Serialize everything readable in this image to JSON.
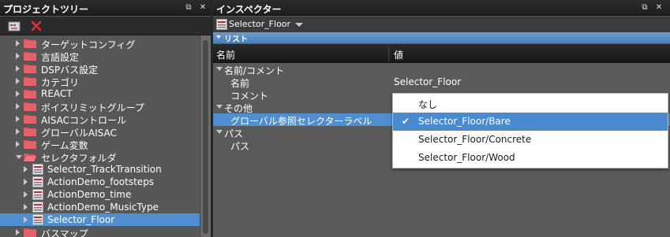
{
  "project_tree": {
    "title": "プロジェクトツリー",
    "items": [
      {
        "label": "ターゲットコンフィグ",
        "kind": "folder",
        "expanded": false,
        "selected": false
      },
      {
        "label": "言語設定",
        "kind": "folder",
        "expanded": false,
        "selected": false
      },
      {
        "label": "DSPバス設定",
        "kind": "folder",
        "expanded": false,
        "selected": false
      },
      {
        "label": "カテゴリ",
        "kind": "folder",
        "expanded": false,
        "selected": false
      },
      {
        "label": "REACT",
        "kind": "folder",
        "expanded": false,
        "selected": false
      },
      {
        "label": "ボイスリミットグループ",
        "kind": "folder",
        "expanded": false,
        "selected": false
      },
      {
        "label": "AISACコントロール",
        "kind": "folder",
        "expanded": false,
        "selected": false
      },
      {
        "label": "グローバルAISAC",
        "kind": "folder",
        "expanded": false,
        "selected": false
      },
      {
        "label": "ゲーム変数",
        "kind": "folder",
        "expanded": false,
        "selected": false
      },
      {
        "label": "セレクタフォルダ",
        "kind": "folder",
        "expanded": true,
        "selected": false
      },
      {
        "label": "Selector_TrackTransition",
        "kind": "item",
        "expanded": false,
        "selected": false
      },
      {
        "label": "ActionDemo_footsteps",
        "kind": "item",
        "expanded": false,
        "selected": false
      },
      {
        "label": "ActionDemo_time",
        "kind": "item",
        "expanded": false,
        "selected": false
      },
      {
        "label": "ActionDemo_MusicType",
        "kind": "item",
        "expanded": false,
        "selected": false
      },
      {
        "label": "Selector_Floor",
        "kind": "item",
        "expanded": false,
        "selected": true
      },
      {
        "label": "バスマップ",
        "kind": "folder",
        "expanded": false,
        "selected": false
      }
    ]
  },
  "inspector": {
    "title": "インスペクター",
    "target": "Selector_Floor",
    "section_label": "リスト",
    "col_name": "名前",
    "col_value": "値",
    "rows": [
      {
        "label": "名前/コメント",
        "level": 0,
        "group": true,
        "value": ""
      },
      {
        "label": "名前",
        "level": 1,
        "group": false,
        "value": "Selector_Floor"
      },
      {
        "label": "コメント",
        "level": 1,
        "group": false,
        "value": ""
      },
      {
        "label": "その他",
        "level": 0,
        "group": true,
        "value": ""
      },
      {
        "label": "グローバル参照セレクターラベル",
        "level": 1,
        "group": false,
        "value": "",
        "selected": true
      },
      {
        "label": "パス",
        "level": 0,
        "group": true,
        "value": ""
      },
      {
        "label": "パス",
        "level": 1,
        "group": false,
        "value": ""
      }
    ]
  },
  "dropdown": {
    "options": [
      {
        "label": "なし",
        "selected": false
      },
      {
        "label": "Selector_Floor/Bare",
        "selected": true
      },
      {
        "label": "Selector_Floor/Concrete",
        "selected": false
      },
      {
        "label": "Selector_Floor/Wood",
        "selected": false
      }
    ],
    "check_glyph": "✔"
  },
  "window_buttons": {
    "restore": "⧉",
    "close": "✕"
  },
  "colors": {
    "selection": "#4f8fcf",
    "folder": "#e0505a",
    "list_bar": "#5a8fc4"
  }
}
